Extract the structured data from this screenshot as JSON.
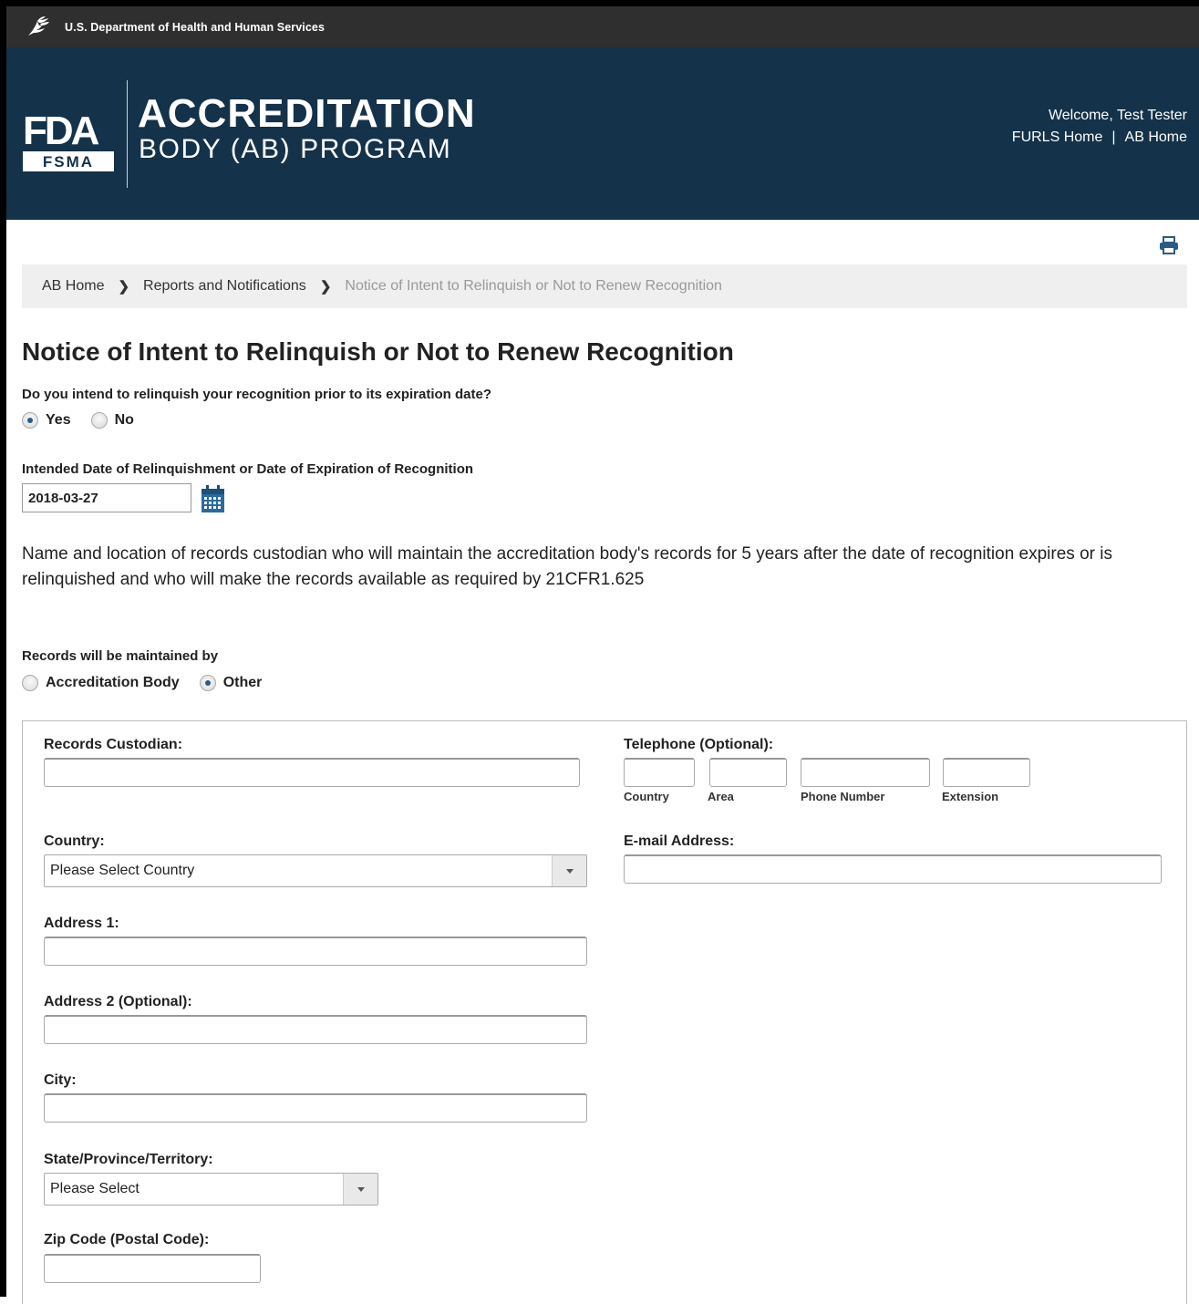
{
  "header": {
    "agency": "U.S. Department of Health and Human Services",
    "program_title_line1": "ACCREDITATION",
    "program_title_line2": "BODY (AB) PROGRAM",
    "logo_text_top": "FDA",
    "logo_text_bottom": "FSMA",
    "welcome": "Welcome, Test Tester",
    "links": {
      "furls_home": "FURLS Home",
      "separator": "|",
      "ab_home": "AB Home"
    }
  },
  "breadcrumb": {
    "items": [
      "AB Home",
      "Reports and Notifications"
    ],
    "current": "Notice of Intent to Relinquish or Not to Renew Recognition"
  },
  "page": {
    "title": "Notice of Intent to Relinquish or Not to Renew Recognition",
    "question1": "Do you intend to relinquish your recognition prior to its expiration date?",
    "q1_options": [
      {
        "label": "Yes",
        "checked": true
      },
      {
        "label": "No",
        "checked": false
      }
    ],
    "date_label": "Intended Date of Relinquishment or Date of Expiration of Recognition",
    "date_value": "2018-03-27",
    "description": "Name and location of records custodian who will maintain the accreditation body's records for 5 years after the date of recognition expires or is relinquished and who will make the records available as required by 21CFR1.625",
    "maintained_label": "Records will be maintained by",
    "maintained_options": [
      {
        "label": "Accreditation Body",
        "checked": false
      },
      {
        "label": "Other",
        "checked": true
      }
    ]
  },
  "form": {
    "records_custodian_label": "Records Custodian:",
    "records_custodian_value": "",
    "telephone_label": "Telephone (Optional):",
    "telephone_sublabels": [
      "Country",
      "Area",
      "Phone Number",
      "Extension"
    ],
    "country_label": "Country:",
    "country_selected": "Please Select Country",
    "email_label": "E-mail Address:",
    "address1_label": "Address 1:",
    "address2_label": "Address 2 (Optional):",
    "city_label": "City:",
    "state_label": "State/Province/Territory:",
    "state_selected": "Please Select",
    "zip_label": "Zip Code (Postal Code):"
  },
  "colors": {
    "banner": "#143249",
    "top_bar": "#2f2f2f",
    "radio_dot": "#2a5b86",
    "breadcrumb_bg": "#efefef"
  },
  "icons": [
    "hhs-eagle-icon",
    "fda-fsma-logo",
    "print-icon",
    "calendar-icon",
    "chevron-right-icon",
    "dropdown-arrow-icon"
  ]
}
